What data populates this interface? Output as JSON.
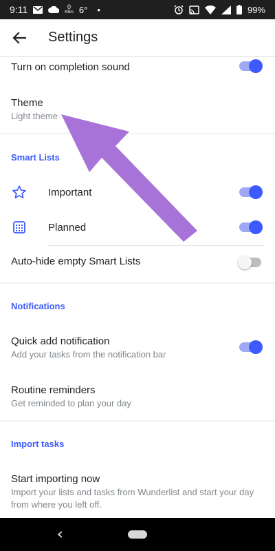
{
  "status_bar": {
    "time": "9:11",
    "net_speed_value": "0",
    "net_speed_unit": "KB/s",
    "temperature": "6°",
    "dot": "•",
    "battery": "99%"
  },
  "app_bar": {
    "title": "Settings"
  },
  "general": {
    "completion_sound": {
      "label": "Turn on completion sound",
      "enabled": true
    },
    "theme": {
      "label": "Theme",
      "value": "Light theme"
    }
  },
  "smart_lists": {
    "header": "Smart Lists",
    "items": [
      {
        "label": "Important",
        "icon": "star-outline-icon",
        "enabled": true
      },
      {
        "label": "Planned",
        "icon": "calendar-icon",
        "enabled": true
      }
    ],
    "auto_hide": {
      "label": "Auto-hide empty Smart Lists",
      "enabled": false
    }
  },
  "notifications": {
    "header": "Notifications",
    "quick_add": {
      "label": "Quick add notification",
      "description": "Add your tasks from the notification bar",
      "enabled": true
    },
    "routine": {
      "label": "Routine reminders",
      "description": "Get reminded to plan your day"
    }
  },
  "import_tasks": {
    "header": "Import tasks",
    "start": {
      "label": "Start importing now",
      "description": "Import your lists and tasks from Wunderlist and start your day from where you left off."
    }
  },
  "colors": {
    "accent": "#3d5afe",
    "annotation_arrow": "#a873d8"
  }
}
